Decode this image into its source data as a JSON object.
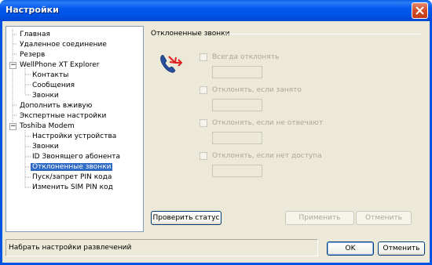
{
  "window": {
    "title": "Настройки"
  },
  "tree": {
    "items": [
      {
        "label": "Главная",
        "level": 0,
        "expander": "",
        "selected": false
      },
      {
        "label": "Удаленное соединение",
        "level": 0,
        "expander": "",
        "selected": false
      },
      {
        "label": "Резерв",
        "level": 0,
        "expander": "",
        "selected": false
      },
      {
        "label": "WellPhone XT Explorer",
        "level": 0,
        "expander": "−",
        "selected": false
      },
      {
        "label": "Контакты",
        "level": 1,
        "expander": "",
        "selected": false
      },
      {
        "label": "Сообщения",
        "level": 1,
        "expander": "",
        "selected": false
      },
      {
        "label": "Звонки",
        "level": 1,
        "expander": "",
        "selected": false
      },
      {
        "label": "Дополнить вживую",
        "level": 0,
        "expander": "",
        "selected": false
      },
      {
        "label": "Экспертные настройки",
        "level": 0,
        "expander": "",
        "selected": false
      },
      {
        "label": "Toshiba Modem",
        "level": 0,
        "expander": "−",
        "selected": false
      },
      {
        "label": "Настройки устройства",
        "level": 1,
        "expander": "",
        "selected": false
      },
      {
        "label": "Звонки",
        "level": 1,
        "expander": "",
        "selected": false
      },
      {
        "label": "ID Звонящего абонента",
        "level": 1,
        "expander": "",
        "selected": false
      },
      {
        "label": "Отклоненные звонки",
        "level": 1,
        "expander": "",
        "selected": true
      },
      {
        "label": "Пуск/запрет PIN кода",
        "level": 1,
        "expander": "",
        "selected": false
      },
      {
        "label": "Изменить SIM PIN код",
        "level": 1,
        "expander": "",
        "selected": false
      }
    ]
  },
  "panel": {
    "group_title": "Отклоненные звонки",
    "icon": "call-divert-icon",
    "options": [
      {
        "label": "Всегда отклонять",
        "checked": false,
        "enabled": false,
        "value": ""
      },
      {
        "label": "Отклонять, если занято",
        "checked": false,
        "enabled": false,
        "value": ""
      },
      {
        "label": "Отклонять, если не отвечают",
        "checked": false,
        "enabled": false,
        "value": ""
      },
      {
        "label": "Отклонять, если нет доступа",
        "checked": false,
        "enabled": false,
        "value": ""
      }
    ],
    "check_status_label": "Проверить статус",
    "apply_label": "Применить",
    "cancel_inner_label": "Отменить"
  },
  "footer": {
    "status_text": "Набрать настройки развлечений",
    "ok_label": "OK",
    "cancel_label": "Отменить"
  },
  "colors": {
    "title_bar": "#0054e3",
    "selection": "#316ac5",
    "dialog_bg": "#ece9d8"
  }
}
